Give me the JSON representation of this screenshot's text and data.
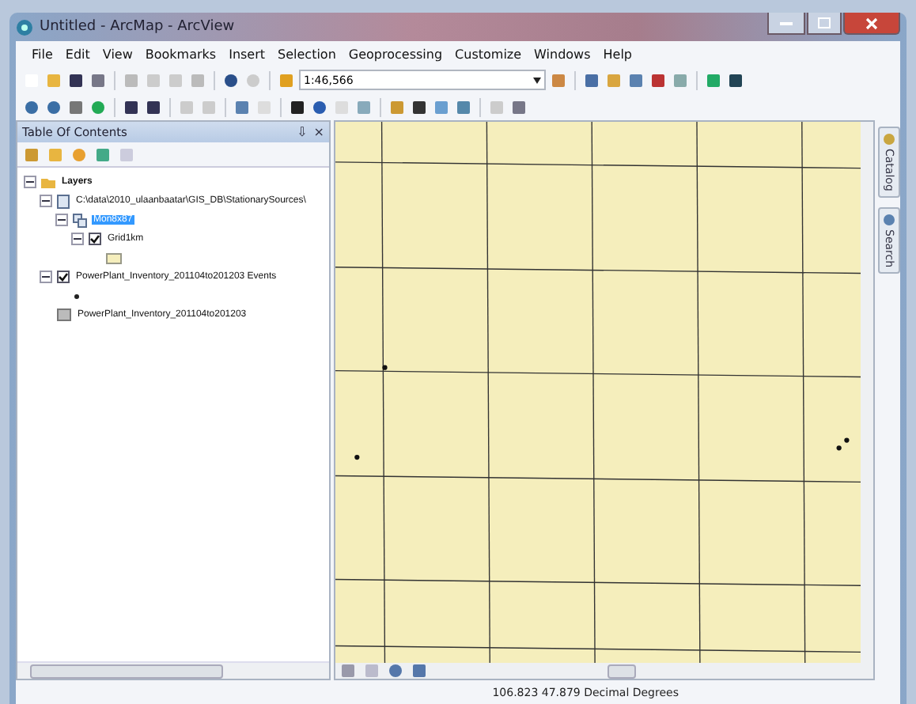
{
  "window": {
    "title": "Untitled - ArcMap - ArcView"
  },
  "menu": [
    "File",
    "Edit",
    "View",
    "Bookmarks",
    "Insert",
    "Selection",
    "Geoprocessing",
    "Customize",
    "Windows",
    "Help"
  ],
  "toolbar": {
    "scale": "1:46,566"
  },
  "toc": {
    "title": "Table Of Contents",
    "close": "×",
    "pin": "⇩",
    "tree": [
      {
        "label": "Layers",
        "kind": "frame",
        "expanded": true,
        "selected": false,
        "children": [
          {
            "label": "C:\\data\\2010_ulaanbaatar\\GIS_DB\\StationarySources\\",
            "kind": "folder",
            "expanded": true,
            "selected": false,
            "children": [
              {
                "label": "Mon8x87",
                "kind": "group",
                "expanded": true,
                "selected": true,
                "children": [
                  {
                    "label": "Grid1km",
                    "kind": "polygon_layer",
                    "expanded": true,
                    "checked": true,
                    "selected": false
                  }
                ]
              }
            ]
          },
          {
            "label": "PowerPlant_Inventory_201104to201203 Events",
            "kind": "point_layer",
            "expanded": true,
            "checked": true,
            "selected": false
          },
          {
            "label": "PowerPlant_Inventory_201104to201203",
            "kind": "table",
            "selected": false
          }
        ]
      }
    ]
  },
  "side_tabs": [
    "Catalog",
    "Search"
  ],
  "status_bar": {
    "coordinates": "106.823  47.879 Decimal Degrees"
  }
}
